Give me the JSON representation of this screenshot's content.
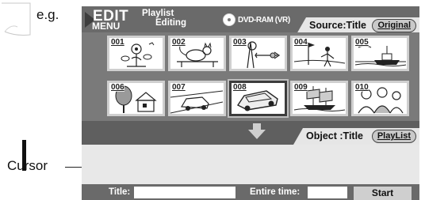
{
  "annotations": {
    "example_label": "e.g.",
    "cursor_label": "Cursor"
  },
  "header": {
    "edit_title": "EDIT",
    "menu_label": "MENU",
    "mode_line1": "Playlist",
    "mode_line2": "Editing",
    "disc_icon": "disc-icon",
    "disc_label": "DVD-RAM (VR)"
  },
  "source": {
    "label": "Source:Title",
    "button": "Original"
  },
  "thumbnails": [
    {
      "number": "001",
      "scene": "flowers-and-bee"
    },
    {
      "number": "002",
      "scene": "cat-on-table"
    },
    {
      "number": "003",
      "scene": "bird-and-dart"
    },
    {
      "number": "004",
      "scene": "golfer"
    },
    {
      "number": "005",
      "scene": "ship-at-sea"
    },
    {
      "number": "006",
      "scene": "house-and-tree"
    },
    {
      "number": "007",
      "scene": "car-on-road"
    },
    {
      "number": "008",
      "scene": "car",
      "selected": true
    },
    {
      "number": "009",
      "scene": "sailing-ship"
    },
    {
      "number": "010",
      "scene": "people-group"
    }
  ],
  "object": {
    "label": "Object :Title",
    "button": "PlayList"
  },
  "footer": {
    "title_label": "Title:",
    "title_value": "",
    "entire_time_label": "Entire time:",
    "entire_time_value": "",
    "start_button": "Start"
  }
}
